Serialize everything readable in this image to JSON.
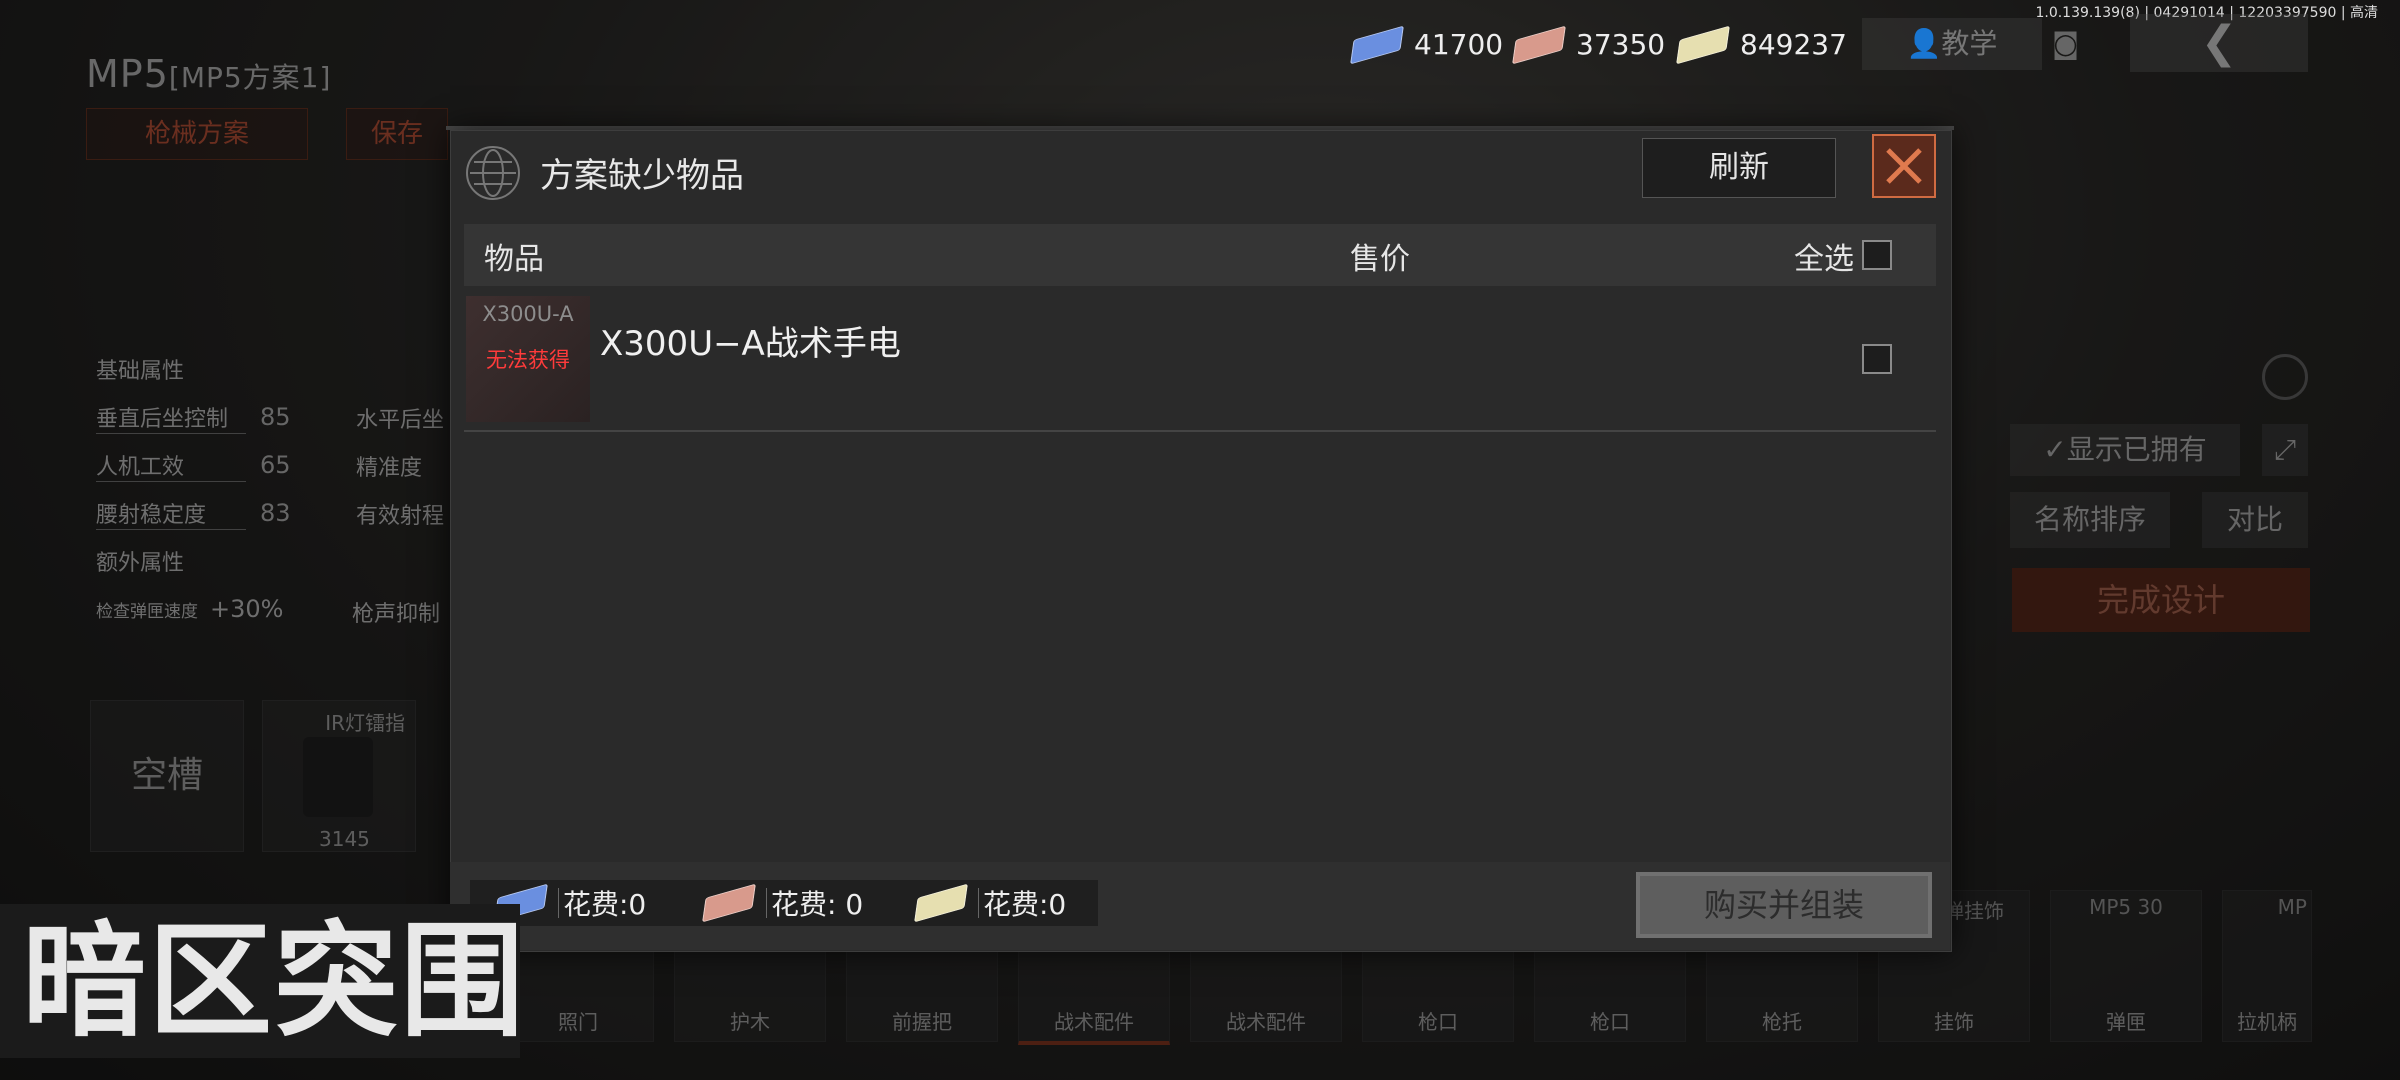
{
  "version_text": "1.0.139.139(8) | 04291014 | 12203397590 | 高清",
  "currencies": [
    {
      "value": "41700",
      "color": "#6a8fe0",
      "icon": "blue-cash-icon"
    },
    {
      "value": "37350",
      "color": "#d89a8c",
      "icon": "red-cash-icon"
    },
    {
      "value": "849237",
      "color": "#e6dfb0",
      "icon": "gold-cash-icon"
    }
  ],
  "top_right": {
    "tutorial_label": "教学"
  },
  "weapon": {
    "name": "MP5",
    "scheme": "[MP5方案1]"
  },
  "left_buttons": {
    "scheme_label": "枪械方案",
    "save_label": "保存"
  },
  "stats": {
    "basic_title": "基础属性",
    "rows": [
      {
        "label": "垂直后坐控制",
        "value": "85"
      },
      {
        "label": "人机工效",
        "value": "65"
      },
      {
        "label": "腰射稳定度",
        "value": "83"
      }
    ],
    "col2": [
      "水平后坐",
      "精准度",
      "有效射程"
    ],
    "extra_title": "额外属性",
    "extra_label": "检查弹匣速度",
    "extra_value": "+30%",
    "extra_label2": "枪声抑制"
  },
  "slots": {
    "empty_label": "空槽",
    "ir_label": "IR灯镭指",
    "ir_value": "3145"
  },
  "right_panel": {
    "show_owned_label": "显示已拥有",
    "sort_name_label": "名称排序",
    "compare_label": "对比",
    "finish_label": "完成设计"
  },
  "bottom_tabs": [
    "照门",
    "护木",
    "前握把",
    "战术配件",
    "战术配件",
    "枪口",
    "枪口",
    "枪托",
    "挂饰",
    "弹匣",
    "拉机柄"
  ],
  "bottom_tab_top_labels": {
    "pendant": "玉佩弹挂饰",
    "mag": "MP5 30",
    "handle": "MP"
  },
  "modal": {
    "title": "方案缺少物品",
    "refresh_label": "刷新",
    "header": {
      "item": "物品",
      "price": "售价",
      "select_all": "全选"
    },
    "items": [
      {
        "thumb_name": "X300U-A",
        "status": "无法获得",
        "name": "X300U−A战术手电"
      }
    ],
    "costs": [
      {
        "label": "花费:0"
      },
      {
        "label": "花费: 0"
      },
      {
        "label": "花费:0"
      }
    ],
    "buy_label": "购买并组装"
  },
  "logo_text": "暗区突围",
  "colors": {
    "accent": "#d06b42",
    "warn": "#ff3b3b"
  }
}
